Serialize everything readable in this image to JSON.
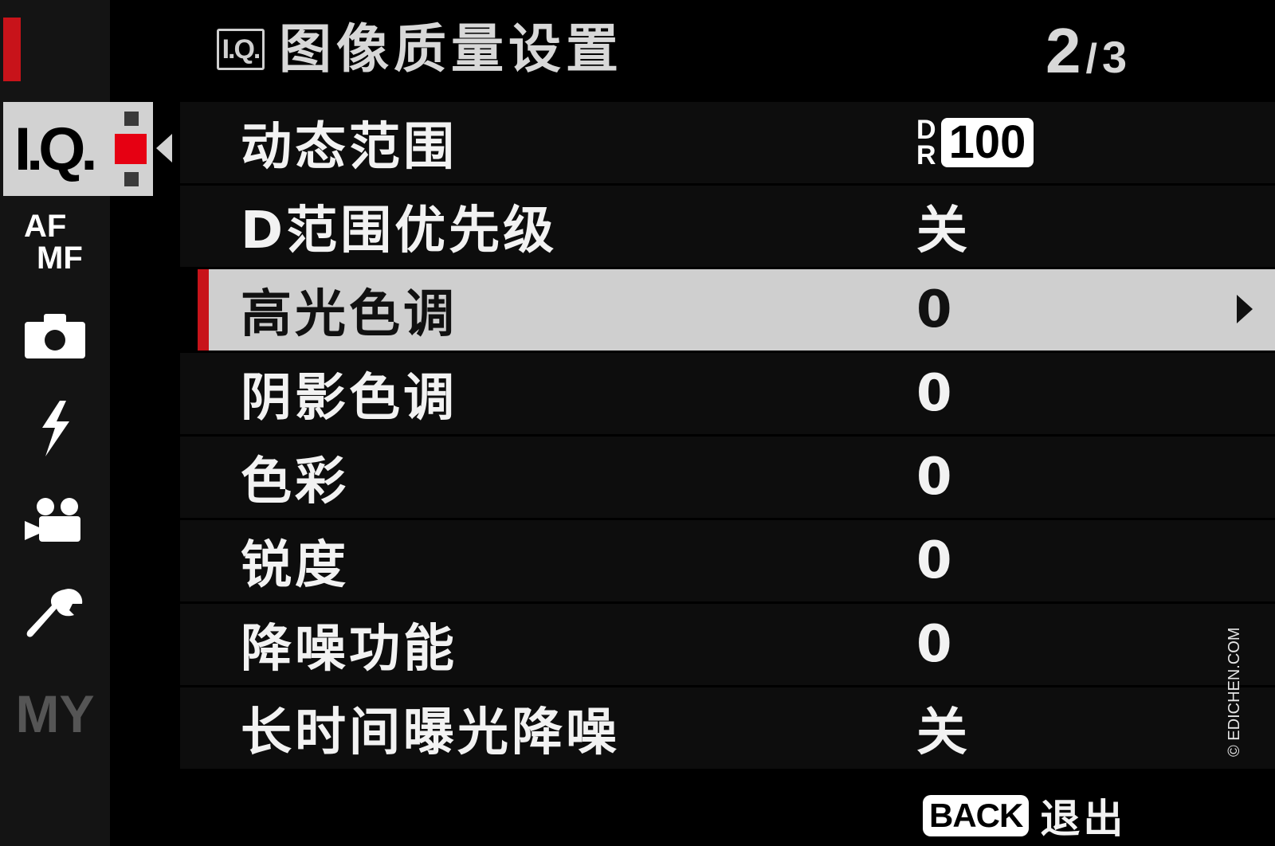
{
  "header": {
    "badge": "I.Q.",
    "title": "图像质量设置",
    "page_current": "2",
    "page_sep": "/",
    "page_total": "3"
  },
  "sidebar": {
    "tabs": [
      {
        "id": "iq",
        "label": "I.Q.",
        "selected": true
      },
      {
        "id": "afmf",
        "label_top": "AF",
        "label_bottom": "MF"
      },
      {
        "id": "shooting",
        "icon": "camera-icon"
      },
      {
        "id": "flash",
        "icon": "flash-icon"
      },
      {
        "id": "movie",
        "icon": "movie-camera-icon"
      },
      {
        "id": "setup",
        "icon": "wrench-icon"
      },
      {
        "id": "my",
        "label": "MY"
      }
    ]
  },
  "menu": {
    "items": [
      {
        "label": "动态范围",
        "value_prefix_top": "D",
        "value_prefix_bottom": "R",
        "value": "100"
      },
      {
        "label": "D范围优先级",
        "value": "关"
      },
      {
        "label": "高光色调",
        "value": "0",
        "selected": true
      },
      {
        "label": "阴影色调",
        "value": "0"
      },
      {
        "label": "色彩",
        "value": "0"
      },
      {
        "label": "锐度",
        "value": "0"
      },
      {
        "label": "降噪功能",
        "value": "0"
      },
      {
        "label": "长时间曝光降噪",
        "value": "关"
      }
    ]
  },
  "footer": {
    "back_key": "BACK",
    "back_label": "退出"
  },
  "watermark": "© EDICHEN.COM",
  "colors": {
    "accent_red": "#c8131a",
    "selection_bg": "#cfcfcf",
    "background": "#000000"
  }
}
